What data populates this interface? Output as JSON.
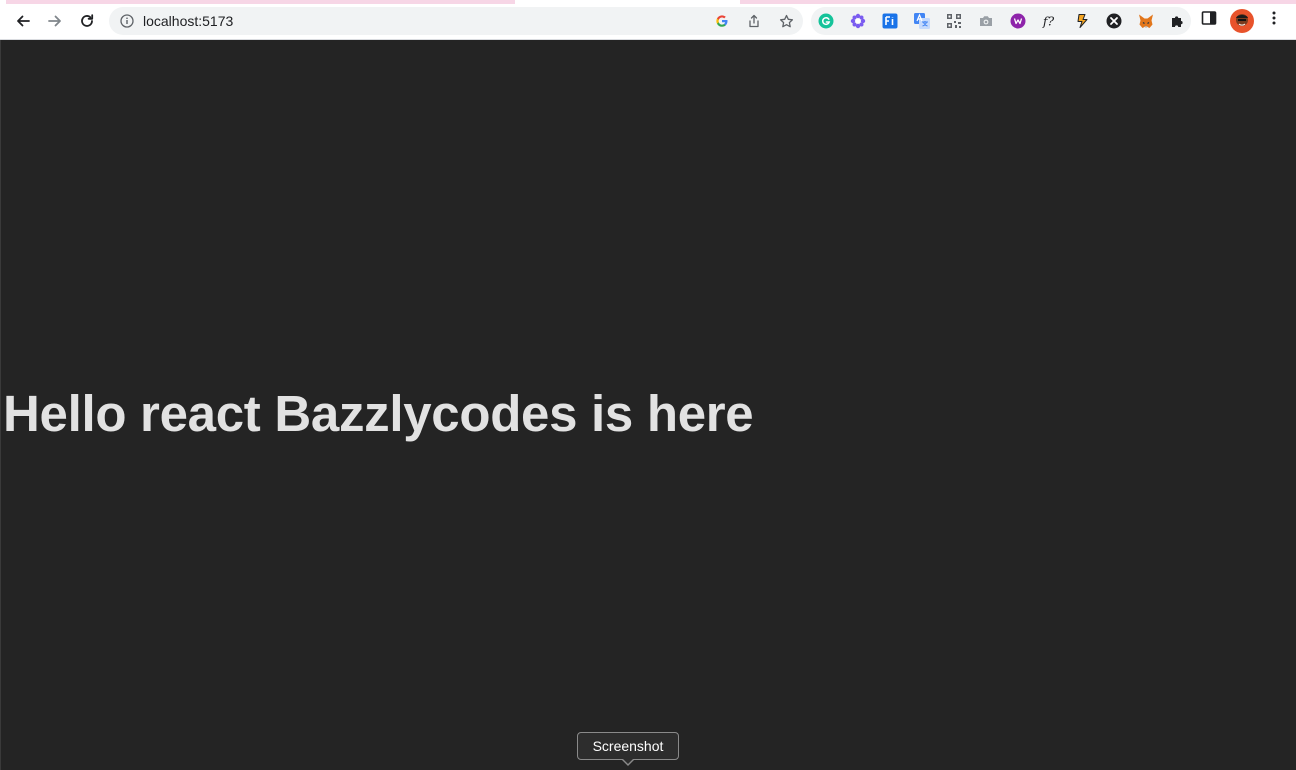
{
  "browser": {
    "url": "localhost:5173",
    "icons": {
      "back": "arrow-left",
      "forward": "arrow-right",
      "reload": "refresh",
      "site_info": "info-circle",
      "google_lens": "google-g",
      "share": "share-up-arrow",
      "bookmark": "star-outline",
      "extensions": [
        "grammarly",
        "flower",
        "fi-extension",
        "google-translate",
        "qr-code",
        "camera-screenshot",
        "purple-w",
        "f-question",
        "sui-wallet",
        "x-circle",
        "metamask-fox"
      ],
      "puzzle": "puzzle-piece",
      "side_panel": "side-panel",
      "profile": "avatar",
      "menu": "kebab-menu"
    }
  },
  "page": {
    "heading": "Hello react Bazzlycodes is here",
    "background_color": "#242424",
    "text_color": "rgba(255,255,255,0.87)"
  },
  "tooltip": {
    "label": "Screenshot"
  }
}
